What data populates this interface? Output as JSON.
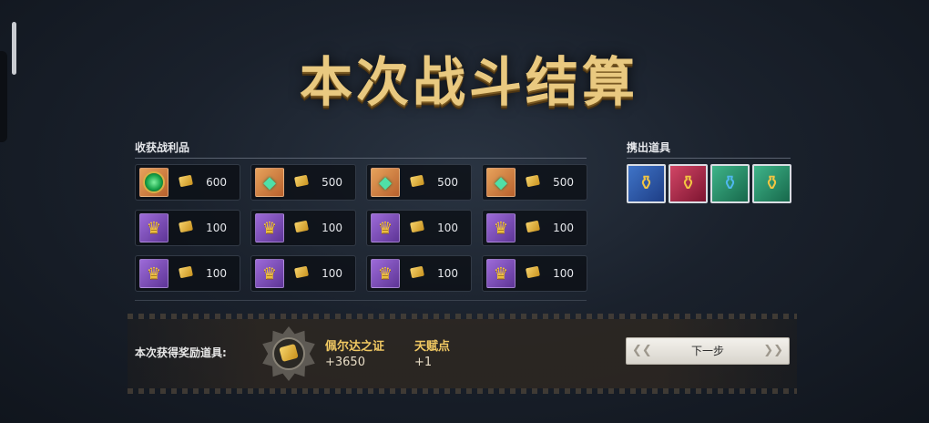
{
  "title": "本次战斗结算",
  "loot": {
    "label": "收获战利品",
    "items": [
      {
        "icon": "emerald-gem-icon",
        "bg": "orange",
        "qty": "600"
      },
      {
        "icon": "green-crystal-icon",
        "bg": "orange",
        "qty": "500"
      },
      {
        "icon": "green-crystal-icon",
        "bg": "orange",
        "qty": "500"
      },
      {
        "icon": "green-crystal-icon",
        "bg": "orange",
        "qty": "500"
      },
      {
        "icon": "gold-crown-icon",
        "bg": "purple",
        "qty": "100"
      },
      {
        "icon": "gold-crown-icon",
        "bg": "purple",
        "qty": "100"
      },
      {
        "icon": "gold-crown-icon",
        "bg": "purple",
        "qty": "100"
      },
      {
        "icon": "gold-crown-icon",
        "bg": "purple",
        "qty": "100"
      },
      {
        "icon": "gold-crown-icon",
        "bg": "purple",
        "qty": "100"
      },
      {
        "icon": "gold-crown-icon",
        "bg": "purple",
        "qty": "100"
      },
      {
        "icon": "gold-crown-icon",
        "bg": "purple",
        "qty": "100"
      },
      {
        "icon": "gold-crown-icon",
        "bg": "purple",
        "qty": "100"
      }
    ]
  },
  "drops": {
    "label": "携出道具",
    "items": [
      {
        "icon": "yellow-potion-icon",
        "bg": "blue"
      },
      {
        "icon": "yellow-potion-icon",
        "bg": "red"
      },
      {
        "icon": "blue-potion-icon",
        "bg": "green"
      },
      {
        "icon": "yellow-potion-icon",
        "bg": "green"
      }
    ]
  },
  "reward": {
    "label": "本次获得奖励道具:",
    "badge_icon": "gold-coin-badge-icon",
    "items": [
      {
        "name": "佩尔达之证",
        "value": "+3650"
      },
      {
        "name": "天赋点",
        "value": "+1"
      }
    ]
  },
  "next_button": {
    "label": "下一步"
  },
  "colors": {
    "title_gold": "#e9c980",
    "reward_gold": "#f0c862",
    "orange_bg": "#e7a25b",
    "purple_bg": "#9c6ad8"
  }
}
